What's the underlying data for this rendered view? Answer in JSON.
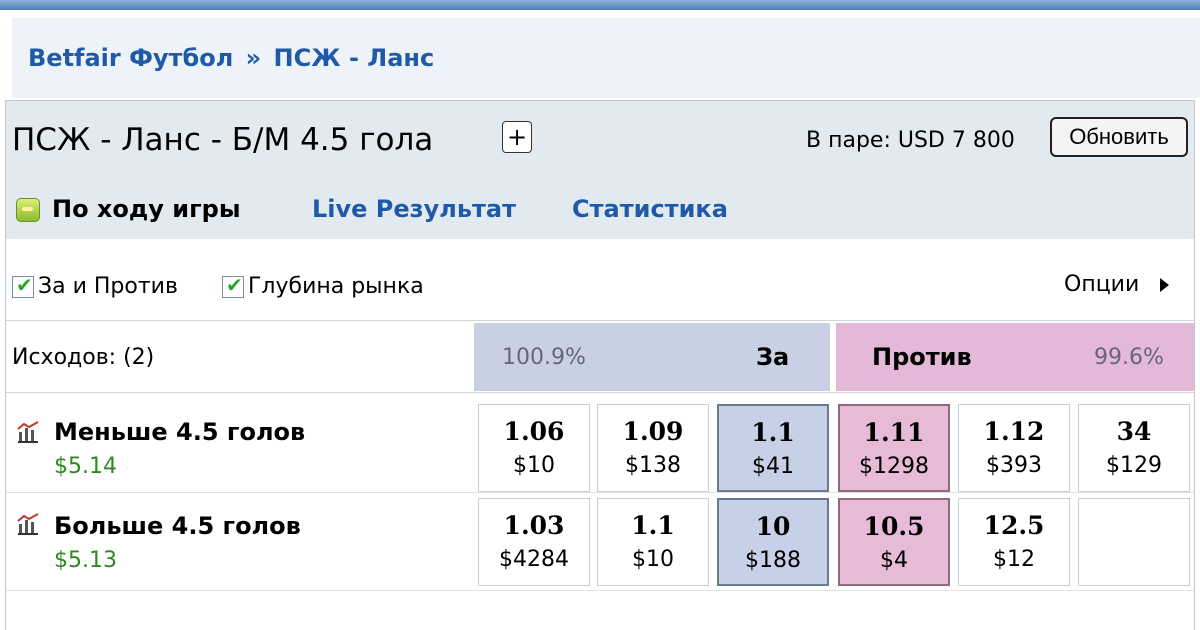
{
  "breadcrumb": {
    "section": "Betfair Футбол",
    "separator": "»",
    "event": "ПСЖ - Ланс"
  },
  "market": {
    "title": "ПСЖ - Ланс - Б/М 4.5 гола",
    "plus_label": "+",
    "matched_label": "В паре: USD 7 800",
    "refresh_label": "Обновить"
  },
  "status_bar": {
    "inplay_label": "По ходу игры",
    "live_link": "Live Результат",
    "stats_link": "Статистика"
  },
  "options_bar": {
    "back_lay_label": "За и Против",
    "depth_label": "Глубина рынка",
    "options_label": "Опции",
    "check_mark": "✔"
  },
  "columns": {
    "runners_label": "Исходов: (2)",
    "back_pct": "100.9%",
    "back_label": "За",
    "lay_label": "Против",
    "lay_pct": "99.6%"
  },
  "runners": [
    {
      "name": "Меньше 4.5 голов",
      "pl": "$5.14",
      "prices": [
        {
          "odds": "1.06",
          "size": "$10"
        },
        {
          "odds": "1.09",
          "size": "$138"
        },
        {
          "odds": "1.1",
          "size": "$41"
        },
        {
          "odds": "1.11",
          "size": "$1298"
        },
        {
          "odds": "1.12",
          "size": "$393"
        },
        {
          "odds": "34",
          "size": "$129"
        }
      ]
    },
    {
      "name": "Больше 4.5 голов",
      "pl": "$5.13",
      "prices": [
        {
          "odds": "1.03",
          "size": "$4284"
        },
        {
          "odds": "1.1",
          "size": "$10"
        },
        {
          "odds": "10",
          "size": "$188"
        },
        {
          "odds": "10.5",
          "size": "$4"
        },
        {
          "odds": "12.5",
          "size": "$12"
        },
        {
          "odds": "",
          "size": ""
        }
      ]
    }
  ],
  "colors": {
    "back": "#c8d0e3",
    "lay": "#e3b9d7",
    "link": "#1f5aa8",
    "profit": "#2d8a1f"
  },
  "icons": {
    "inplay": "inplay-icon",
    "chart": "chart-icon",
    "options": "arrow-right-icon"
  }
}
